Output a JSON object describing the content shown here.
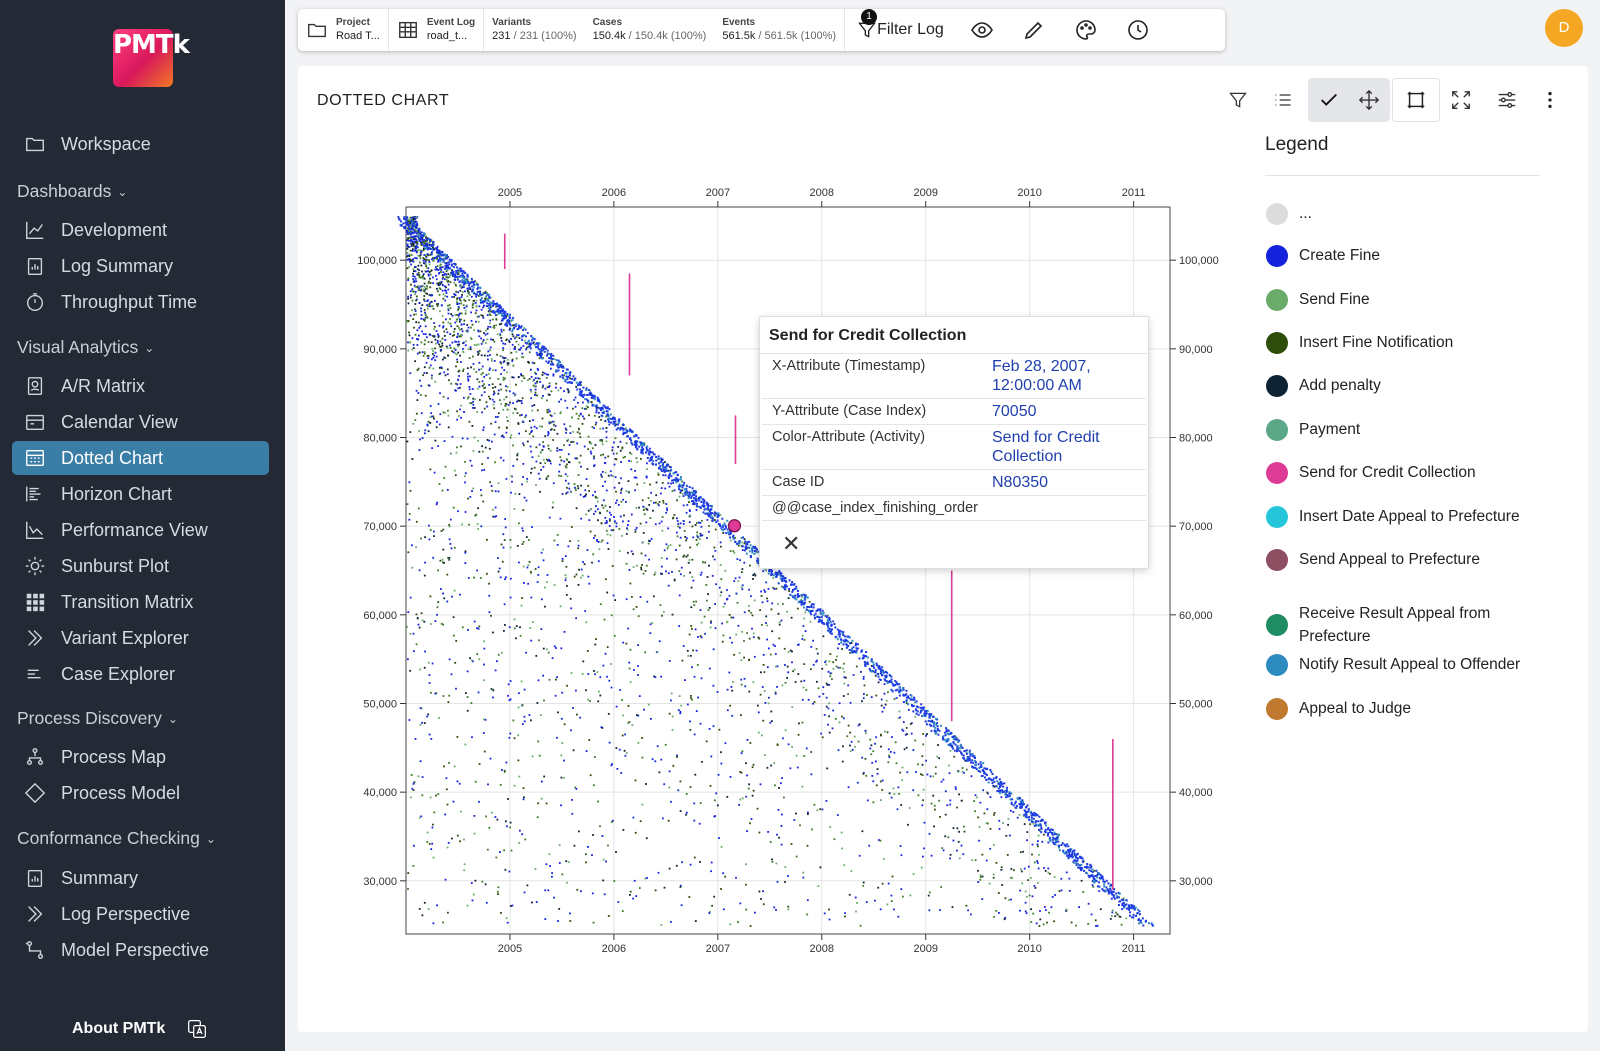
{
  "app": {
    "logo_text": "PMTk",
    "about_label": "About PMTk"
  },
  "sidebar": {
    "workspace": "Workspace",
    "groups": [
      {
        "label": "Dashboards",
        "items": [
          "Development",
          "Log Summary",
          "Throughput Time"
        ]
      },
      {
        "label": "Visual Analytics",
        "items": [
          "A/R Matrix",
          "Calendar View",
          "Dotted Chart",
          "Horizon Chart",
          "Performance View",
          "Sunburst Plot",
          "Transition Matrix",
          "Variant Explorer",
          "Case Explorer"
        ]
      },
      {
        "label": "Process Discovery",
        "items": [
          "Process Map",
          "Process Model"
        ]
      },
      {
        "label": "Conformance Checking",
        "items": [
          "Summary",
          "Log Perspective",
          "Model Perspective"
        ]
      }
    ],
    "active": "Dotted Chart"
  },
  "toolbar": {
    "project_label": "Project",
    "project_value": "Road T...",
    "eventlog_label": "Event Log",
    "eventlog_value": "road_t...",
    "variants_label": "Variants",
    "variants_value": "231",
    "variants_total": "/ 231 (100%)",
    "cases_label": "Cases",
    "cases_value": "150.4k",
    "cases_total": "/ 150.4k (100%)",
    "events_label": "Events",
    "events_value": "561.5k",
    "events_total": "/ 561.5k (100%)",
    "filter_label": "Filter Log",
    "filter_badge": "1"
  },
  "user": {
    "initial": "D"
  },
  "panel": {
    "title": "DOTTED CHART"
  },
  "chart_data": {
    "type": "scatter",
    "x_ticks": [
      "2005",
      "2006",
      "2007",
      "2008",
      "2009",
      "2010",
      "2011"
    ],
    "y_ticks": [
      "100,000",
      "90,000",
      "80,000",
      "70,000",
      "60,000",
      "50,000",
      "40,000",
      "30,000"
    ],
    "y_tick_values": [
      100000,
      90000,
      80000,
      70000,
      60000,
      50000,
      40000,
      30000
    ],
    "xlim": [
      2004.0,
      2011.35
    ],
    "ylim": [
      24000,
      106000
    ],
    "staircase_x": [
      2004.95,
      2006.15,
      2007.17,
      2009.25,
      2010.8
    ],
    "staircase_y": [
      [
        99000,
        103000
      ],
      [
        87000,
        98500
      ],
      [
        77000,
        82500
      ],
      [
        48000,
        65000
      ],
      [
        29000,
        46000
      ]
    ],
    "selected_point": {
      "x": 2007.16,
      "y": 70050
    }
  },
  "tooltip": {
    "title": "Send for Credit Collection",
    "rows": [
      {
        "key": "X-Attribute (Timestamp)",
        "value": "Feb 28, 2007, 12:00:00 AM"
      },
      {
        "key": "Y-Attribute (Case Index)",
        "value": "70050"
      },
      {
        "key": "Color-Attribute (Activity)",
        "value": "Send for Credit Collection"
      },
      {
        "key": "Case ID",
        "value": "N80350"
      },
      {
        "key": "@@case_index_finishing_order",
        "value": ""
      }
    ]
  },
  "legend": {
    "title": "Legend",
    "items": [
      {
        "label": "...",
        "color": "#dcdcdc"
      },
      {
        "label": "Create Fine",
        "color": "#1523de"
      },
      {
        "label": "Send Fine",
        "color": "#6aab6a"
      },
      {
        "label": "Insert Fine Notification",
        "color": "#2e4d0a"
      },
      {
        "label": "Add penalty",
        "color": "#0d2233"
      },
      {
        "label": "Payment",
        "color": "#5aa888"
      },
      {
        "label": "Send for Credit Collection",
        "color": "#dd3b95"
      },
      {
        "label": "Insert Date Appeal to Prefecture",
        "color": "#26c6da"
      },
      {
        "label": "Send Appeal to Prefecture",
        "color": "#8e4f63"
      },
      {
        "label": "Receive Result Appeal from Prefecture",
        "color": "#1f8c63"
      },
      {
        "label": "Notify Result Appeal to Offender",
        "color": "#2d8bc0"
      },
      {
        "label": "Appeal to Judge",
        "color": "#c07a30"
      }
    ]
  }
}
